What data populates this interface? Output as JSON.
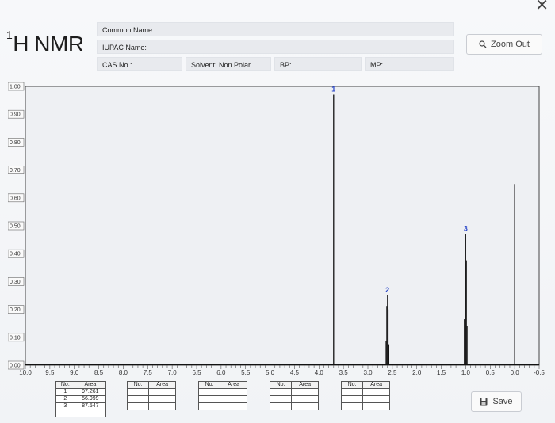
{
  "window": {
    "close_glyph": "✕"
  },
  "app_title": {
    "sup": "1",
    "main": "H NMR"
  },
  "fields": {
    "common_name": "Common Name:",
    "iupac_name": "IUPAC Name:",
    "cas_no": "CAS No.:",
    "solvent": "Solvent: Non Polar",
    "bp": "BP:",
    "mp": "MP:"
  },
  "buttons": {
    "zoom_out": "Zoom Out",
    "save": "Save"
  },
  "icons": {
    "zoom": "search-icon",
    "save": "floppy-disk-icon"
  },
  "colors": {
    "peak_label": "#2c49c9",
    "trace": "#111111"
  },
  "integration_tables": [
    {
      "headers": [
        "No.",
        "Area"
      ],
      "rows": [
        [
          "1",
          "97.261"
        ],
        [
          "2",
          "56.999"
        ],
        [
          "3",
          "87.547"
        ]
      ]
    },
    {
      "headers": [
        "No.",
        "Area"
      ],
      "rows": [
        [
          "",
          ""
        ],
        [
          "",
          ""
        ],
        [
          "",
          ""
        ]
      ]
    },
    {
      "headers": [
        "No.",
        "Area"
      ],
      "rows": [
        [
          "",
          ""
        ],
        [
          "",
          ""
        ],
        [
          "",
          ""
        ]
      ]
    },
    {
      "headers": [
        "No.",
        "Area"
      ],
      "rows": [
        [
          "",
          ""
        ],
        [
          "",
          ""
        ],
        [
          "",
          ""
        ]
      ]
    },
    {
      "headers": [
        "No.",
        "Area"
      ],
      "rows": [
        [
          "",
          ""
        ],
        [
          "",
          ""
        ],
        [
          "",
          ""
        ]
      ]
    }
  ],
  "chart_data": {
    "type": "line",
    "title": "",
    "xlabel": "",
    "ylabel": "",
    "xlim": [
      10.0,
      -0.5
    ],
    "ylim": [
      0.0,
      1.0
    ],
    "x_reversed": true,
    "yticks": [
      "0.00",
      "0.10",
      "0.20",
      "0.30",
      "0.40",
      "0.50",
      "0.60",
      "0.70",
      "0.80",
      "0.90",
      "1.00"
    ],
    "xticks": [
      "10.0",
      "9.5",
      "9.0",
      "8.5",
      "8.0",
      "7.5",
      "7.0",
      "6.5",
      "6.0",
      "5.5",
      "5.0",
      "4.5",
      "4.0",
      "3.5",
      "3.0",
      "2.5",
      "2.0",
      "1.5",
      "1.0",
      "0.5",
      "0.0",
      "-0.5"
    ],
    "peaks": [
      {
        "label": "1",
        "ppm": 3.7,
        "height": 0.97
      },
      {
        "label": "2",
        "ppm": 2.6,
        "height": 0.25,
        "multiplet": true
      },
      {
        "label": "3",
        "ppm": 1.0,
        "height": 0.47,
        "multiplet": true
      },
      {
        "label": "",
        "ppm": 0.0,
        "height": 0.65
      }
    ]
  }
}
